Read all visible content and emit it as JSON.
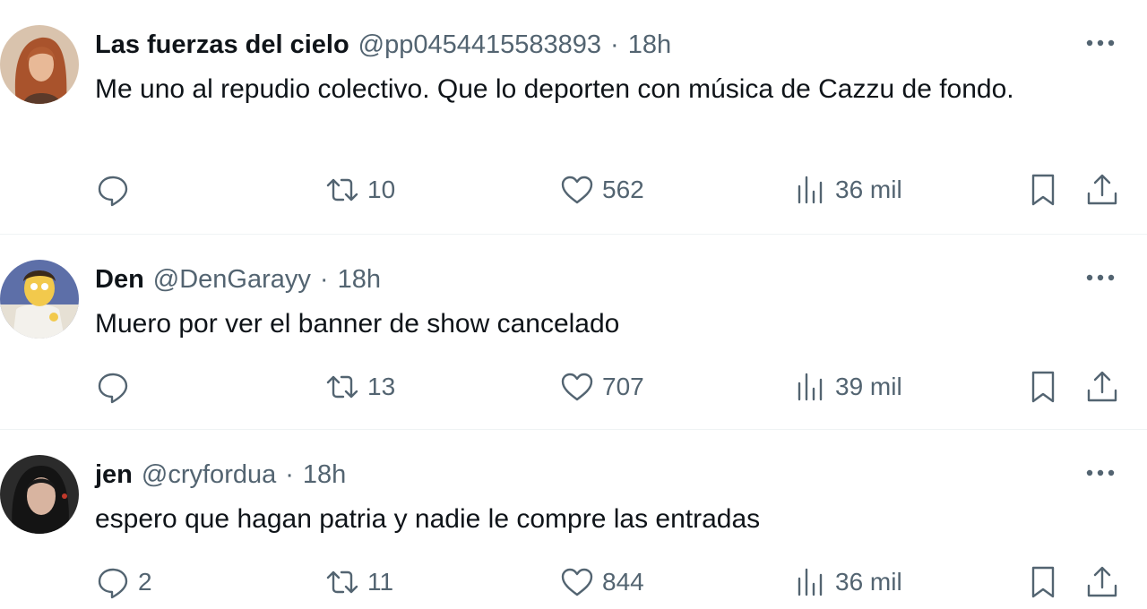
{
  "tweets": [
    {
      "name": "Las fuerzas del cielo",
      "handle": "@pp0454415583893",
      "sep": "·",
      "time": "18h",
      "text": "Me uno al repudio colectivo. Que lo deporten con música de Cazzu de fondo.",
      "replies": "",
      "retweets": "10",
      "likes": "562",
      "views": "36 mil"
    },
    {
      "name": "Den",
      "handle": "@DenGarayy",
      "sep": "·",
      "time": "18h",
      "text": "Muero por ver el banner de show cancelado",
      "replies": "",
      "retweets": "13",
      "likes": "707",
      "views": "39 mil"
    },
    {
      "name": "jen",
      "handle": "@cryfordua",
      "sep": "·",
      "time": "18h",
      "text": "espero que hagan patria y nadie le compre las entradas",
      "replies": "2",
      "retweets": "11",
      "likes": "844",
      "views": "36 mil"
    }
  ],
  "icons": {
    "reply": "reply-icon",
    "retweet": "retweet-icon",
    "like": "heart-icon",
    "views": "views-icon",
    "bookmark": "bookmark-icon",
    "share": "share-icon",
    "more": "more-icon"
  },
  "colors": {
    "text": "#0f1419",
    "secondary": "#536471",
    "divider": "#eff3f4"
  }
}
